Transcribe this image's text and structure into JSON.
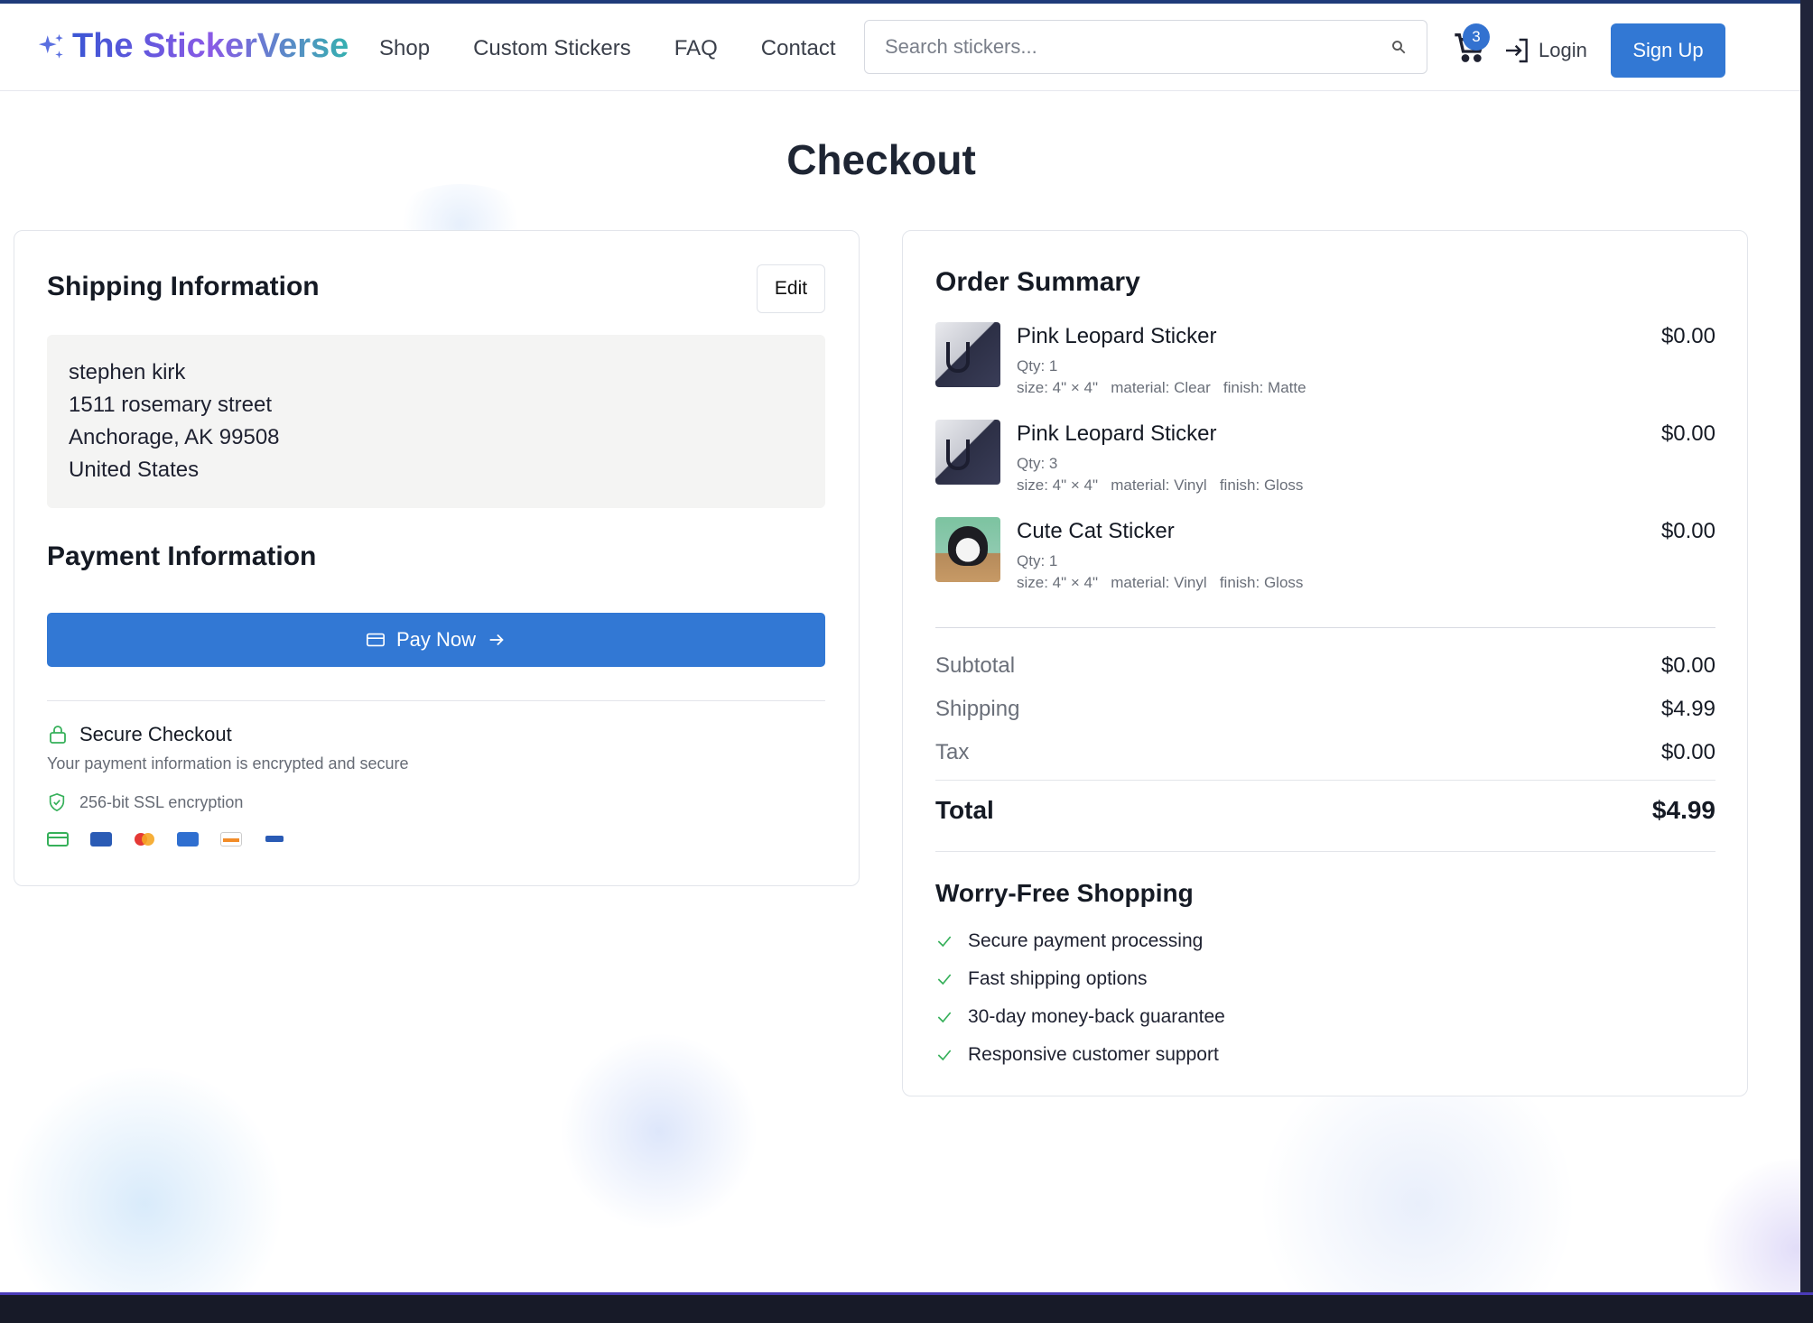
{
  "header": {
    "logo_text": "The StickerVerse",
    "nav": [
      "Shop",
      "Custom Stickers",
      "FAQ",
      "Contact"
    ],
    "search_placeholder": "Search stickers...",
    "cart_count": "3",
    "login_label": "Login",
    "signup_label": "Sign Up"
  },
  "page": {
    "title": "Checkout"
  },
  "shipping": {
    "title": "Shipping Information",
    "edit_label": "Edit",
    "address_lines": [
      "stephen kirk",
      "1511 rosemary street",
      "Anchorage, AK 99508",
      "United States"
    ]
  },
  "payment": {
    "title": "Payment Information",
    "pay_label": "Pay Now",
    "secure_title": "Secure Checkout",
    "secure_sub": "Your payment information is encrypted and secure",
    "ssl_label": "256-bit SSL encryption",
    "card_icons": [
      "card-icon",
      "visa-icon",
      "mastercard-icon",
      "amex-icon",
      "discover-icon",
      "jcb-icon"
    ]
  },
  "summary": {
    "title": "Order Summary",
    "items": [
      {
        "name": "Pink Leopard Sticker",
        "qty": "Qty: 1",
        "attrs": "size: 4\" × 4\"   material: Clear   finish: Matte",
        "price": "$0.00",
        "thumb": "leopard"
      },
      {
        "name": "Pink Leopard Sticker",
        "qty": "Qty: 3",
        "attrs": "size: 4\" × 4\"   material: Vinyl   finish: Gloss",
        "price": "$0.00",
        "thumb": "leopard"
      },
      {
        "name": "Cute Cat Sticker",
        "qty": "Qty: 1",
        "attrs": "size: 4\" × 4\"   material: Vinyl   finish: Gloss",
        "price": "$0.00",
        "thumb": "cat"
      }
    ],
    "subtotal_label": "Subtotal",
    "subtotal": "$0.00",
    "shipping_label": "Shipping",
    "shipping": "$4.99",
    "tax_label": "Tax",
    "tax": "$0.00",
    "total_label": "Total",
    "total": "$4.99"
  },
  "worry_free": {
    "title": "Worry-Free Shopping",
    "items": [
      "Secure payment processing",
      "Fast shipping options",
      "30-day money-back guarantee",
      "Responsive customer support"
    ]
  },
  "colors": {
    "accent": "#3278d4",
    "success": "#36b05a",
    "title": "#1e2533"
  }
}
